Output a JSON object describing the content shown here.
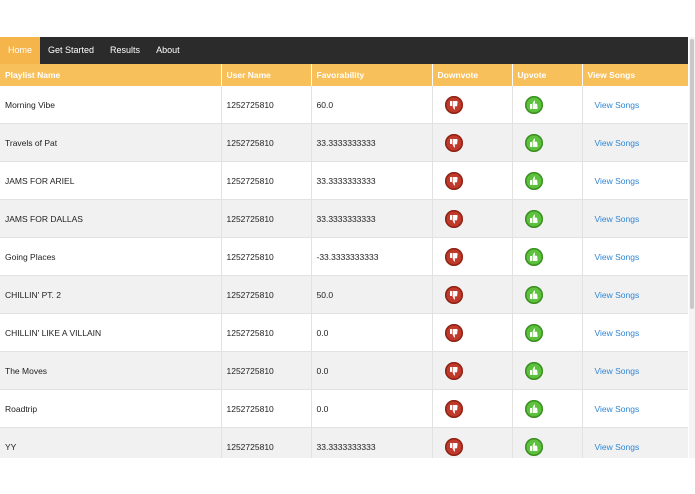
{
  "nav": {
    "items": [
      {
        "label": "Home",
        "active": true
      },
      {
        "label": "Get Started",
        "active": false
      },
      {
        "label": "Results",
        "active": false
      },
      {
        "label": "About",
        "active": false
      }
    ]
  },
  "table": {
    "headers": {
      "playlist_name": "Playlist Name",
      "user_name": "User Name",
      "favorability": "Favorability",
      "downvote": "Downvote",
      "upvote": "Upvote",
      "view_songs": "View Songs"
    },
    "rows": [
      {
        "playlist": "Morning Vibe",
        "user": "1252725810",
        "favorability": "60.0",
        "link": "View Songs"
      },
      {
        "playlist": "Travels of Pat",
        "user": "1252725810",
        "favorability": "33.3333333333",
        "link": "View Songs"
      },
      {
        "playlist": "JAMS FOR ARIEL",
        "user": "1252725810",
        "favorability": "33.3333333333",
        "link": "View Songs"
      },
      {
        "playlist": "JAMS FOR DALLAS",
        "user": "1252725810",
        "favorability": "33.3333333333",
        "link": "View Songs"
      },
      {
        "playlist": "Going Places",
        "user": "1252725810",
        "favorability": "-33.3333333333",
        "link": "View Songs"
      },
      {
        "playlist": "CHILLIN' PT. 2",
        "user": "1252725810",
        "favorability": "50.0",
        "link": "View Songs"
      },
      {
        "playlist": "CHILLIN' LIKE A VILLAIN",
        "user": "1252725810",
        "favorability": "0.0",
        "link": "View Songs"
      },
      {
        "playlist": "The Moves",
        "user": "1252725810",
        "favorability": "0.0",
        "link": "View Songs"
      },
      {
        "playlist": "Roadtrip",
        "user": "1252725810",
        "favorability": "0.0",
        "link": "View Songs"
      },
      {
        "playlist": "YY",
        "user": "1252725810",
        "favorability": "33.3333333333",
        "link": "View Songs"
      }
    ]
  },
  "icons": {
    "downvote": "thumbs-down-icon",
    "upvote": "thumbs-up-icon"
  },
  "colors": {
    "navbar": "#2b2b2b",
    "accent": "#f8c05a",
    "downvote": "#c0392b",
    "upvote": "#5cc23b",
    "link": "#2f86d6"
  }
}
